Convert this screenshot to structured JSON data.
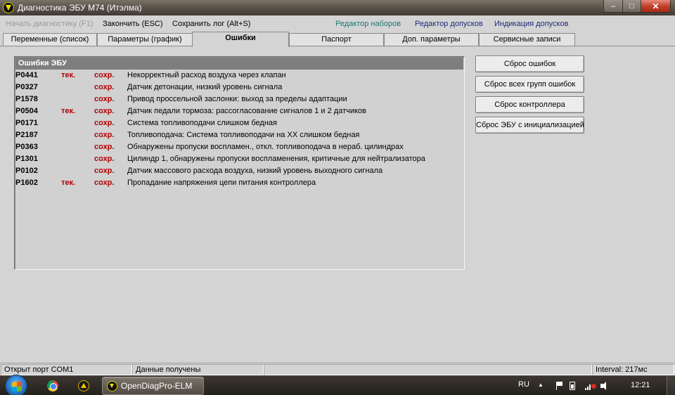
{
  "window": {
    "title": "Диагностика ЭБУ М74 (Итэлма)",
    "buttons": {
      "minimize": "‒",
      "maximize": "□",
      "close": "✕"
    }
  },
  "menu": {
    "start_diag": "Начать диагностику (F1)",
    "finish": "Закончить (ESC)",
    "save_log": "Сохранить лог (Alt+S)",
    "set_editor": "Редактор наборов",
    "tolerance_editor": "Редактор допусков",
    "tolerance_indication": "Индикация допусков"
  },
  "tabs": [
    {
      "label": "Переменные (список)"
    },
    {
      "label": "Параметры (график)"
    },
    {
      "label": "Ошибки"
    },
    {
      "label": "Паспорт"
    },
    {
      "label": "Доп. параметры"
    },
    {
      "label": "Сервисные записи"
    }
  ],
  "errors_panel": {
    "header": "Ошибки ЭБУ",
    "rows": [
      {
        "code": "P0441",
        "current": "тек.",
        "saved": "сохр.",
        "desc": "Некорректный расход воздуха через клапан"
      },
      {
        "code": "P0327",
        "current": "",
        "saved": "сохр.",
        "desc": "Датчик детонации, низкий уровень сигнала"
      },
      {
        "code": "P1578",
        "current": "",
        "saved": "сохр.",
        "desc": "Привод проссельной заслонки: выход за пределы адаптации"
      },
      {
        "code": "P0504",
        "current": "тек.",
        "saved": "сохр.",
        "desc": "Датчик педали тормоза: рассогласование сигналов 1 и 2 датчиков"
      },
      {
        "code": "P0171",
        "current": "",
        "saved": "сохр.",
        "desc": "Система топливоподачи слишком бедная"
      },
      {
        "code": "P2187",
        "current": "",
        "saved": "сохр.",
        "desc": "Топливоподача: Система топливоподачи на ХХ слишком бедная"
      },
      {
        "code": "P0363",
        "current": "",
        "saved": "сохр.",
        "desc": "Обнаружены пропуски воспламен., откл. топливоподача в нераб. цилиндрах"
      },
      {
        "code": "P1301",
        "current": "",
        "saved": "сохр.",
        "desc": "Цилиндр 1, обнаружены пропуски воспламенения, критичные для нейтрализатора"
      },
      {
        "code": "P0102",
        "current": "",
        "saved": "сохр.",
        "desc": "Датчик массового расхода воздуха, низкий уровень выходного сигнала"
      },
      {
        "code": "P1602",
        "current": "тек.",
        "saved": "сохр.",
        "desc": "Пропадание напряжения цепи питания контроллера"
      }
    ]
  },
  "actions": {
    "reset_errors": "Сброс ошибок",
    "reset_all_groups": "Сброс всех групп ошибок",
    "reset_controller": "Сброс контроллера",
    "reset_ecu_init": "Сброс ЭБУ с инициализацией"
  },
  "status": {
    "port": "Открыт порт COM1",
    "data": "Данные получены",
    "blank": "",
    "interval": "Interval: 217мс"
  },
  "taskbar": {
    "app_label": "OpenDiagPro-ELM",
    "language": "RU",
    "tray_up": "▲",
    "clock": "12:21",
    "icons": [
      "windows-start-icon",
      "chrome-icon",
      "warning-triangle-icon",
      "opendiag-icon",
      "flag-icon",
      "battery-icon",
      "signal-icon",
      "volume-icon"
    ]
  }
}
